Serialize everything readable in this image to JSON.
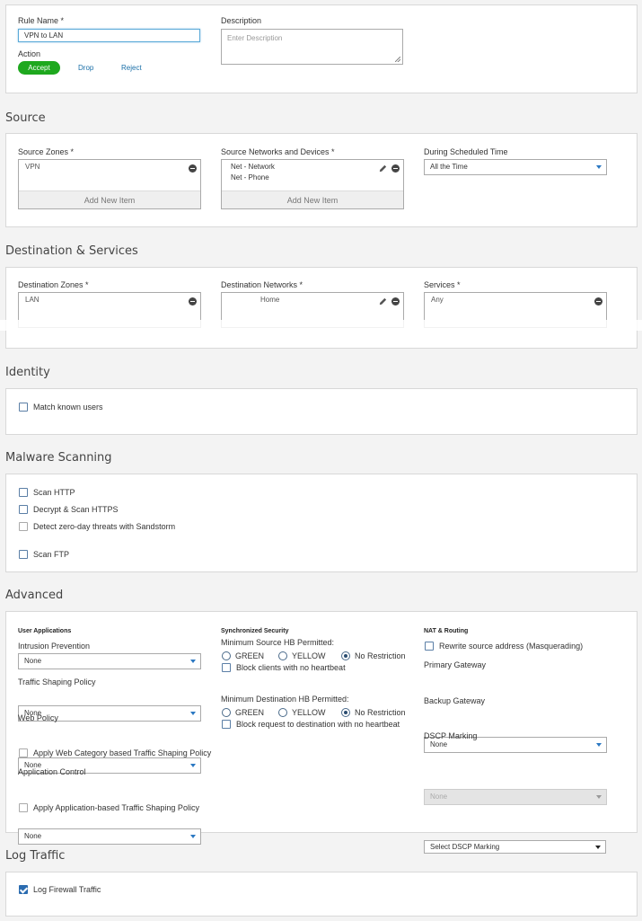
{
  "rule": {
    "name_label": "Rule Name *",
    "name_value": "VPN to LAN",
    "description_label": "Description",
    "description_placeholder": "Enter Description",
    "action_label": "Action",
    "actions": [
      "Accept",
      "Drop",
      "Reject"
    ],
    "selected_action": "Accept"
  },
  "source": {
    "title": "Source",
    "zones_label": "Source Zones *",
    "zones": [
      "VPN"
    ],
    "networks_label": "Source Networks and Devices *",
    "networks": [
      "Net - Network",
      "Net - Phone"
    ],
    "add_new_item": "Add New Item",
    "schedule_label": "During Scheduled Time",
    "schedule_value": "All the Time"
  },
  "destination": {
    "title": "Destination & Services",
    "zones_label": "Destination Zones *",
    "zones": [
      "LAN"
    ],
    "networks_label": "Destination Networks *",
    "networks": [
      "Home"
    ],
    "services_label": "Services *",
    "services": [
      "Any"
    ]
  },
  "identity": {
    "title": "Identity",
    "match_known_users": "Match known users"
  },
  "malware": {
    "title": "Malware Scanning",
    "scan_http": "Scan HTTP",
    "decrypt_https": "Decrypt & Scan HTTPS",
    "sandstorm": "Detect zero-day threats with Sandstorm",
    "scan_ftp": "Scan FTP"
  },
  "advanced": {
    "title": "Advanced",
    "user_apps": {
      "heading": "User Applications",
      "ips_label": "Intrusion Prevention",
      "ips_value": "None",
      "shaping_label": "Traffic Shaping Policy",
      "shaping_value": "None",
      "web_label": "Web Policy",
      "web_value": "None",
      "web_category_shaping": "Apply Web Category based Traffic Shaping Policy",
      "app_control_label": "Application Control",
      "app_control_value": "None",
      "app_shaping": "Apply Application-based Traffic Shaping Policy"
    },
    "sync_security": {
      "heading": "Synchronized Security",
      "min_source_label": "Minimum Source HB Permitted:",
      "min_dest_label": "Minimum Destination HB Permitted:",
      "options": [
        "GREEN",
        "YELLOW",
        "No Restriction"
      ],
      "selected": "No Restriction",
      "block_clients": "Block clients with no heartbeat",
      "block_request": "Block request to destination with no heartbeat"
    },
    "nat": {
      "heading": "NAT & Routing",
      "masquerade": "Rewrite source address (Masquerading)",
      "primary_gateway_label": "Primary Gateway",
      "primary_gateway_value": "None",
      "backup_gateway_label": "Backup Gateway",
      "backup_gateway_value": "None",
      "dscp_label": "DSCP Marking",
      "dscp_value": "Select DSCP Marking"
    }
  },
  "log": {
    "title": "Log Traffic",
    "log_firewall": "Log Firewall Traffic",
    "log_firewall_checked": true
  },
  "colors": {
    "accept_green": "#1ea81e",
    "link_blue": "#1a6fa8",
    "checkbox_blue": "#2b6cb0",
    "focus_border": "#5aa9d8"
  }
}
